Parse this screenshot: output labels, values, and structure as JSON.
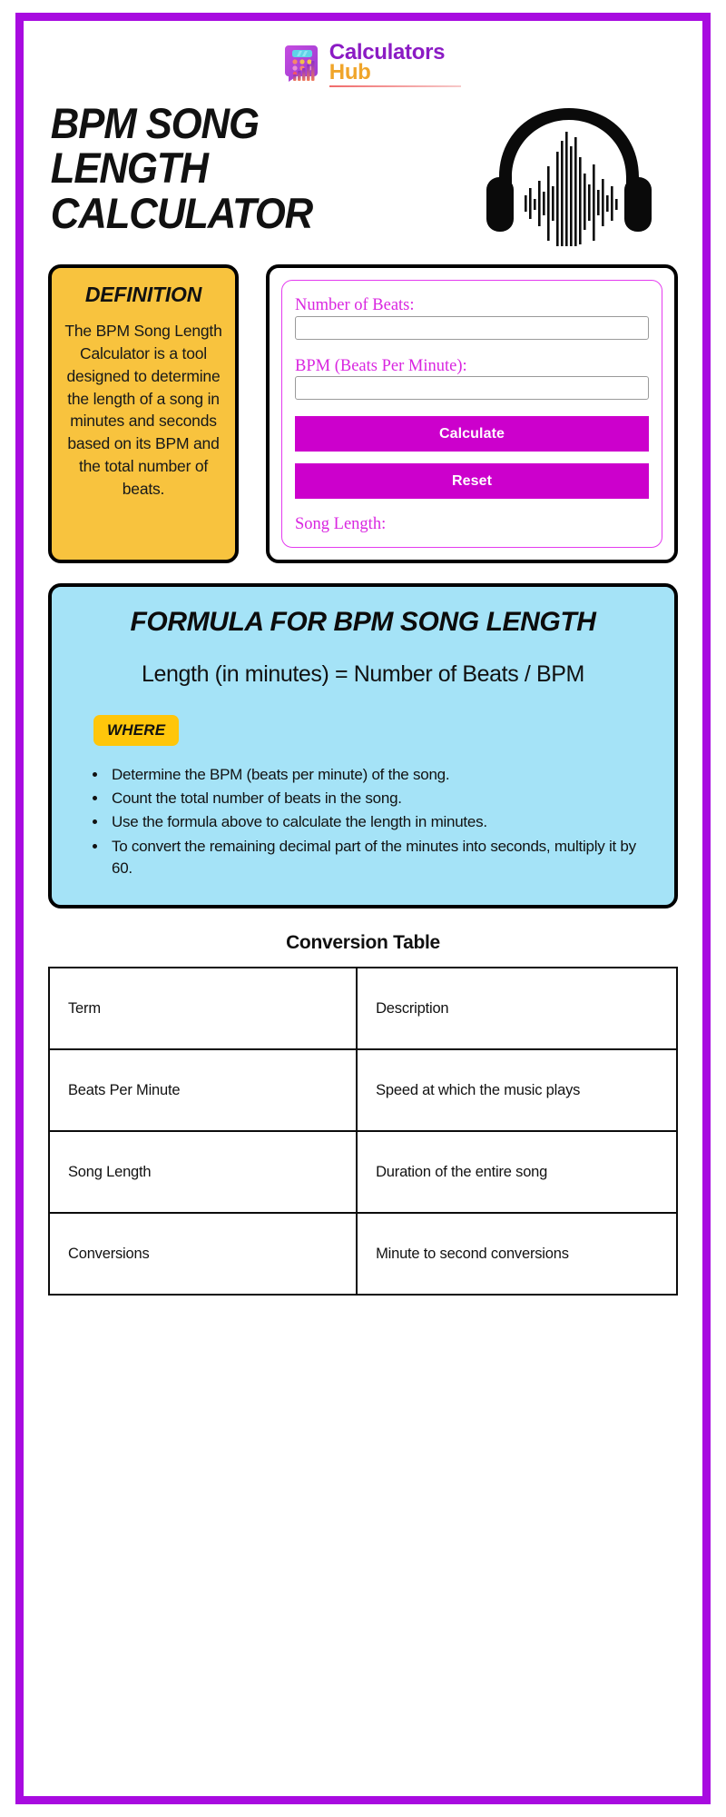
{
  "brand": {
    "logo_icon": "calculator-bars-icon",
    "name_part_1": "Calculators",
    "name_part_2": "Hub"
  },
  "hero": {
    "title": "BPM SONG LENGTH CALCULATOR",
    "artwork_icon": "headphones-waveform-icon"
  },
  "definition": {
    "heading": "DEFINITION",
    "body": "The BPM Song Length Calculator is a tool designed to determine the length of a song in minutes and seconds based on its BPM and the total number of beats.",
    "background_color": "#F8C33E"
  },
  "calculator": {
    "accent_color": "#CC00CC",
    "border_color": "#E43BEF",
    "fields": [
      {
        "label": "Number of Beats:",
        "value": "",
        "placeholder": ""
      },
      {
        "label": "BPM (Beats Per Minute):",
        "value": "",
        "placeholder": ""
      }
    ],
    "calculate_label": "Calculate",
    "reset_label": "Reset",
    "result_label": "Song Length:"
  },
  "formula": {
    "heading": "FORMULA FOR BPM SONG LENGTH",
    "expression": "Length (in minutes) = Number of Beats / BPM",
    "where_badge": "WHERE",
    "background_color": "#A5E3F7",
    "badge_color": "#FFC60B",
    "steps": [
      "Determine the BPM (beats per minute) of the song.",
      "Count the total number of beats in the song.",
      "Use the formula above to calculate the length in minutes.",
      "To convert the remaining decimal part of the minutes into seconds, multiply it by 60."
    ]
  },
  "conversion_table": {
    "title": "Conversion Table",
    "headers": [
      "Term",
      "Description"
    ],
    "rows": [
      [
        "Beats Per Minute",
        "Speed at which the music plays"
      ],
      [
        "Song Length",
        "Duration of the entire song"
      ],
      [
        "Conversions",
        "Minute to second conversions"
      ]
    ]
  },
  "theme": {
    "page_border_color": "#A80BE0"
  }
}
